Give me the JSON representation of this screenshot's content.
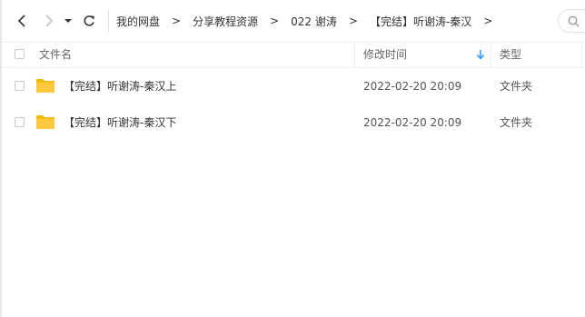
{
  "breadcrumb": [
    "我的网盘",
    "分享教程资源",
    "022 谢涛",
    "【完结】听谢涛-秦汉"
  ],
  "breadcrumb_separator": ">",
  "header": {
    "name": "文件名",
    "time": "修改时间",
    "type": "类型"
  },
  "sort": {
    "column": "time",
    "direction": "desc",
    "color": "#1e90ff"
  },
  "rows": [
    {
      "name": "【完结】听谢涛-秦汉上",
      "time": "2022-02-20 20:09",
      "type": "文件夹"
    },
    {
      "name": "【完结】听谢涛-秦汉下",
      "time": "2022-02-20 20:09",
      "type": "文件夹"
    }
  ],
  "colors": {
    "folder": "#ffc83d",
    "accent": "#1e90ff",
    "text": "#333333",
    "divider": "#eeeeee"
  },
  "icons": [
    "back-icon",
    "forward-icon",
    "dropdown-icon",
    "refresh-icon",
    "search-icon",
    "sort-down-icon",
    "folder-icon"
  ]
}
